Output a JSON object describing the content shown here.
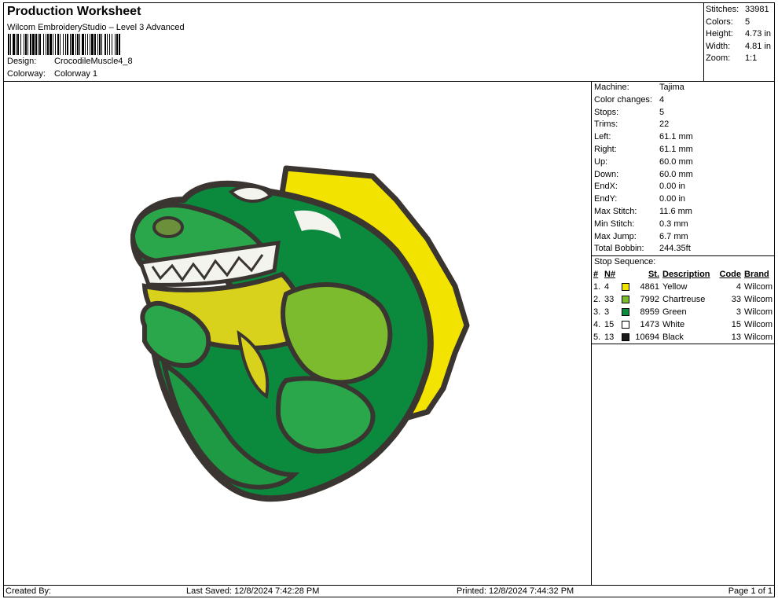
{
  "header": {
    "title": "Production Worksheet",
    "software": "Wilcom EmbroideryStudio – Level 3 Advanced",
    "design_label": "Design:",
    "design_value": "CrocodileMuscle4_8",
    "colorway_label": "Colorway:",
    "colorway_value": "Colorway 1"
  },
  "summary": [
    {
      "label": "Stitches:",
      "value": "33981"
    },
    {
      "label": "Colors:",
      "value": "5"
    },
    {
      "label": "Height:",
      "value": "4.73 in"
    },
    {
      "label": "Width:",
      "value": "4.81 in"
    },
    {
      "label": "Zoom:",
      "value": "1:1"
    }
  ],
  "machine_info": [
    {
      "label": "Machine:",
      "value": "Tajima"
    },
    {
      "label": "Color changes:",
      "value": "4"
    },
    {
      "label": "Stops:",
      "value": "5"
    },
    {
      "label": "Trims:",
      "value": "22"
    },
    {
      "label": "Left:",
      "value": "61.1 mm"
    },
    {
      "label": "Right:",
      "value": "61.1 mm"
    },
    {
      "label": "Up:",
      "value": "60.0 mm"
    },
    {
      "label": "Down:",
      "value": "60.0 mm"
    },
    {
      "label": "EndX:",
      "value": "0.00 in"
    },
    {
      "label": "EndY:",
      "value": "0.00 in"
    },
    {
      "label": "Max Stitch:",
      "value": "11.6 mm"
    },
    {
      "label": "Min Stitch:",
      "value": "0.3 mm"
    },
    {
      "label": "Max Jump:",
      "value": "6.7 mm"
    },
    {
      "label": "Total Bobbin:",
      "value": "244.35ft"
    }
  ],
  "stop_sequence": {
    "title": "Stop Sequence:",
    "headers": {
      "idx": "#",
      "n": "N#",
      "st": "St.",
      "desc": "Description",
      "code": "Code",
      "brand": "Brand"
    },
    "rows": [
      {
        "idx": "1.",
        "n": "4",
        "color": "#f2e400",
        "st": "4861",
        "desc": "Yellow",
        "code": "4",
        "brand": "Wilcom"
      },
      {
        "idx": "2.",
        "n": "33",
        "color": "#7dbb2e",
        "st": "7992",
        "desc": "Chartreuse",
        "code": "33",
        "brand": "Wilcom"
      },
      {
        "idx": "3.",
        "n": "3",
        "color": "#0b8a3e",
        "st": "8959",
        "desc": "Green",
        "code": "3",
        "brand": "Wilcom"
      },
      {
        "idx": "4.",
        "n": "15",
        "color": "#ffffff",
        "st": "1473",
        "desc": "White",
        "code": "15",
        "brand": "Wilcom"
      },
      {
        "idx": "5.",
        "n": "13",
        "color": "#1a1a1a",
        "st": "10694",
        "desc": "Black",
        "code": "13",
        "brand": "Wilcom"
      }
    ]
  },
  "footer": {
    "created_by": "Created By:",
    "last_saved": "Last Saved: 12/8/2024 7:42:28 PM",
    "printed": "Printed: 12/8/2024 7:44:32 PM",
    "page": "Page 1 of 1"
  }
}
